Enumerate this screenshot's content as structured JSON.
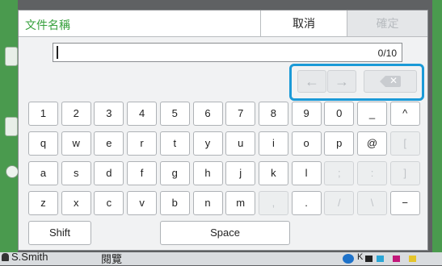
{
  "dialog": {
    "title": "文件名稱",
    "cancel_label": "取消",
    "confirm_label": "確定"
  },
  "input": {
    "value": "",
    "counter": "0/10"
  },
  "arrows": {
    "left": "←",
    "right": "→",
    "delete_x": "✕"
  },
  "keyboard": {
    "row1": [
      "1",
      "2",
      "3",
      "4",
      "5",
      "6",
      "7",
      "8",
      "9",
      "0",
      "_",
      "^"
    ],
    "row2": [
      "q",
      "w",
      "e",
      "r",
      "t",
      "y",
      "u",
      "i",
      "o",
      "p",
      "@",
      "["
    ],
    "row3": [
      "a",
      "s",
      "d",
      "f",
      "g",
      "h",
      "j",
      "k",
      "l",
      ";",
      ":",
      "]"
    ],
    "row4": [
      "z",
      "x",
      "c",
      "v",
      "b",
      "n",
      "m",
      ",",
      ".",
      "/",
      "\\",
      "−"
    ],
    "shift": "Shift",
    "space": "Space"
  },
  "background": {
    "user": "S.Smith",
    "middle": "閱覽",
    "ink_k": "K"
  },
  "colors": {
    "title_green": "#36a03c",
    "highlight_blue": "#1b9ad7",
    "bg_green": "#4a9a4e"
  }
}
